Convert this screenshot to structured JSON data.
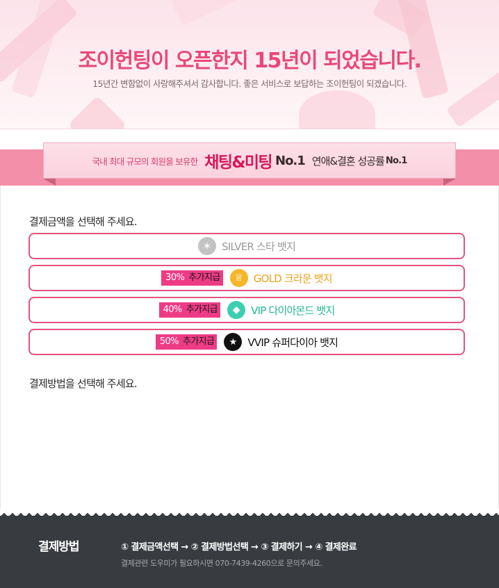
{
  "banner": {
    "title": "조이헌팅이 오픈한지 15년이 되었습니다.",
    "subtitle": "15년간 변함없이 사랑해주셔서 감사합니다.  좋은 서비스로 보답하는 조이헌팅이 되겠습니다."
  },
  "ribbon": {
    "lead": "국내 최대 규모의 회원을 보유한",
    "main": "채팅&미팅",
    "no1": "No.1",
    "secondary": "연애&결혼 성공률",
    "secondary_no1": "No.1"
  },
  "amount_section": {
    "title": "결제금액을 선택해 주세요.",
    "options": [
      {
        "bonus_pct": "",
        "bonus_label": "",
        "badge": "SILVER 스타 뱃지",
        "icon": "star-icon",
        "color": "#9a9a9a"
      },
      {
        "bonus_pct": "30%",
        "bonus_label": "추가지급",
        "badge": "GOLD 크라운 뱃지",
        "icon": "crown-icon",
        "color": "#eaa21b"
      },
      {
        "bonus_pct": "40%",
        "bonus_label": "추가지급",
        "badge": "VIP 다이아몬드 뱃지",
        "icon": "diamond-icon",
        "color": "#23b894"
      },
      {
        "bonus_pct": "50%",
        "bonus_label": "추가지급",
        "badge": "VVIP 슈퍼다이아 뱃지",
        "icon": "super-diamond-icon",
        "color": "#111111"
      }
    ]
  },
  "method_section": {
    "title": "결제방법을 선택해 주세요."
  },
  "footer": {
    "title": "결제방법",
    "steps": "① 결제금액선택 → ② 결제방법선택 → ③ 결제하기 → ④ 결제완료",
    "help": "결제관련 도우미가 필요하시면 070-7439-4260으로 문의주세요."
  },
  "colors": {
    "accent": "#e0547e",
    "bonus_bg": "#ee3b86",
    "footer_bg": "#383c40"
  }
}
